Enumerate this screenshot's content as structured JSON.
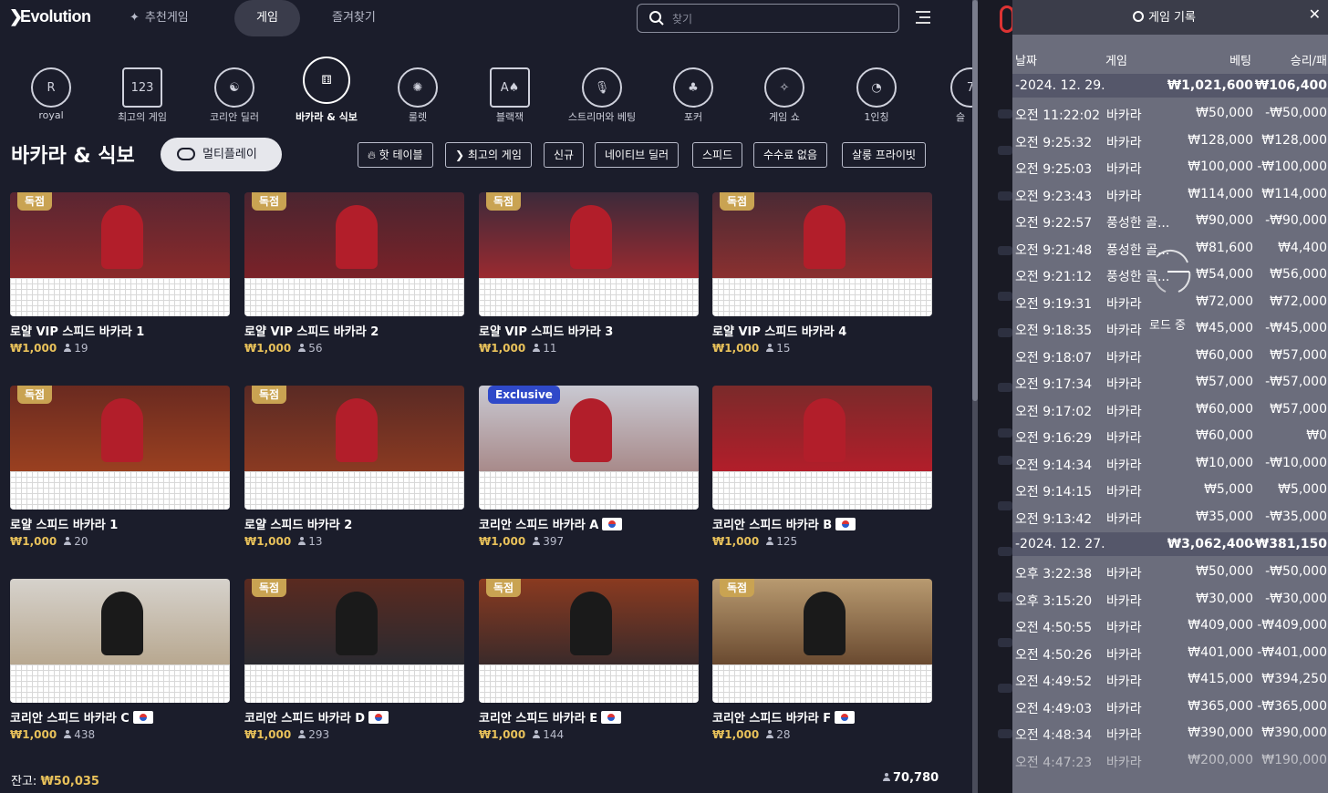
{
  "brand": {
    "name": "Evolution"
  },
  "nav": {
    "tabs": [
      {
        "label": "추천게임",
        "active": false
      },
      {
        "label": "게임",
        "active": true
      },
      {
        "label": "즐겨찾기",
        "active": false
      }
    ],
    "search_placeholder": "찾기"
  },
  "categories": [
    {
      "label": "royal",
      "icon": "royal-crest-icon"
    },
    {
      "label": "최고의 게임",
      "icon": "podium-icon"
    },
    {
      "label": "코리안 딜러",
      "icon": "korean-dealer-icon"
    },
    {
      "label": "바카라 & 식보",
      "icon": "baccarat-dice-icon",
      "active": true
    },
    {
      "label": "룰렛",
      "icon": "roulette-icon"
    },
    {
      "label": "블랙잭",
      "icon": "cards-icon"
    },
    {
      "label": "스트리머와 베팅",
      "icon": "microphone-icon"
    },
    {
      "label": "포커",
      "icon": "poker-icon"
    },
    {
      "label": "게임 쇼",
      "icon": "game-show-icon"
    },
    {
      "label": "1인칭",
      "icon": "first-person-icon"
    },
    {
      "label": "슬",
      "icon": "slot-icon"
    }
  ],
  "section": {
    "title": "바카라 & 식보",
    "multiplay_label": "멀티플레이",
    "filters": [
      "핫 테이블",
      "최고의 게임",
      "신규",
      "네이티브 딜러",
      "스피드",
      "수수료 없음",
      "살룽 프라이빗"
    ]
  },
  "tables": [
    {
      "name": "로얄 VIP 스피드 바카라 1",
      "price": "₩1,000",
      "players": "19",
      "badge": "독점",
      "flag": false
    },
    {
      "name": "로얄 VIP 스피드 바카라 2",
      "price": "₩1,000",
      "players": "56",
      "badge": "독점",
      "flag": false
    },
    {
      "name": "로얄 VIP 스피드 바카라 3",
      "price": "₩1,000",
      "players": "11",
      "badge": "독점",
      "flag": false
    },
    {
      "name": "로얄 VIP 스피드 바카라 4",
      "price": "₩1,000",
      "players": "15",
      "badge": "독점",
      "flag": false
    },
    {
      "name": "로얄 스피드 바카라 1",
      "price": "₩1,000",
      "players": "20",
      "badge": "독점",
      "flag": false
    },
    {
      "name": "로얄 스피드 바카라 2",
      "price": "₩1,000",
      "players": "13",
      "badge": "독점",
      "flag": false
    },
    {
      "name": "코리안 스피드 바카라 A",
      "price": "₩1,000",
      "players": "397",
      "badge": "Exclusive",
      "flag": true
    },
    {
      "name": "코리안 스피드 바카라 B",
      "price": "₩1,000",
      "players": "125",
      "badge": "",
      "flag": true
    },
    {
      "name": "코리안 스피드 바카라 C",
      "price": "₩1,000",
      "players": "438",
      "badge": "",
      "flag": true
    },
    {
      "name": "코리안 스피드 바카라 D",
      "price": "₩1,000",
      "players": "293",
      "badge": "독점",
      "flag": true
    },
    {
      "name": "코리안 스피드 바카라 E",
      "price": "₩1,000",
      "players": "144",
      "badge": "독점",
      "flag": true
    },
    {
      "name": "코리안 스피드 바카라 F",
      "price": "₩1,000",
      "players": "28",
      "badge": "독점",
      "flag": true
    }
  ],
  "footer": {
    "balance_label": "잔고:",
    "balance_value": "₩50,035",
    "online_count": "70,780"
  },
  "history": {
    "title": "게임 기록",
    "close": "✕",
    "columns": {
      "date": "날짜",
      "game": "게임",
      "bet": "베팅",
      "result": "승리/패"
    },
    "loading_text": "로드 중",
    "groups": [
      {
        "date": "-2024. 12. 29.",
        "bet_total": "₩1,021,600",
        "win_total": "₩106,400",
        "rows": [
          {
            "time": "오전 11:22:02",
            "game": "바카라",
            "bet": "₩50,000",
            "result": "-₩50,000"
          },
          {
            "time": "오전 9:25:32",
            "game": "바카라",
            "bet": "₩128,000",
            "result": "₩128,000"
          },
          {
            "time": "오전 9:25:03",
            "game": "바카라",
            "bet": "₩100,000",
            "result": "-₩100,000"
          },
          {
            "time": "오전 9:23:43",
            "game": "바카라",
            "bet": "₩114,000",
            "result": "₩114,000"
          },
          {
            "time": "오전 9:22:57",
            "game": "풍성한 골...",
            "bet": "₩90,000",
            "result": "-₩90,000"
          },
          {
            "time": "오전 9:21:48",
            "game": "풍성한 골...",
            "bet": "₩81,600",
            "result": "₩4,400"
          },
          {
            "time": "오전 9:21:12",
            "game": "풍성한 골...",
            "bet": "₩54,000",
            "result": "₩56,000"
          },
          {
            "time": "오전 9:19:31",
            "game": "바카라",
            "bet": "₩72,000",
            "result": "₩72,000"
          },
          {
            "time": "오전 9:18:35",
            "game": "바카라",
            "bet": "₩45,000",
            "result": "-₩45,000"
          },
          {
            "time": "오전 9:18:07",
            "game": "바카라",
            "bet": "₩60,000",
            "result": "₩57,000"
          },
          {
            "time": "오전 9:17:34",
            "game": "바카라",
            "bet": "₩57,000",
            "result": "-₩57,000"
          },
          {
            "time": "오전 9:17:02",
            "game": "바카라",
            "bet": "₩60,000",
            "result": "₩57,000"
          },
          {
            "time": "오전 9:16:29",
            "game": "바카라",
            "bet": "₩60,000",
            "result": "₩0"
          },
          {
            "time": "오전 9:14:34",
            "game": "바카라",
            "bet": "₩10,000",
            "result": "-₩10,000"
          },
          {
            "time": "오전 9:14:15",
            "game": "바카라",
            "bet": "₩5,000",
            "result": "₩5,000"
          },
          {
            "time": "오전 9:13:42",
            "game": "바카라",
            "bet": "₩35,000",
            "result": "-₩35,000"
          }
        ]
      },
      {
        "date": "-2024. 12. 27.",
        "bet_total": "₩3,062,400",
        "win_total": "-₩381,150",
        "rows": [
          {
            "time": "오후 3:22:38",
            "game": "바카라",
            "bet": "₩50,000",
            "result": "-₩50,000"
          },
          {
            "time": "오후 3:15:20",
            "game": "바카라",
            "bet": "₩30,000",
            "result": "-₩30,000"
          },
          {
            "time": "오전 4:50:55",
            "game": "바카라",
            "bet": "₩409,000",
            "result": "-₩409,000"
          },
          {
            "time": "오전 4:50:26",
            "game": "바카라",
            "bet": "₩401,000",
            "result": "-₩401,000"
          },
          {
            "time": "오전 4:49:52",
            "game": "바카라",
            "bet": "₩415,000",
            "result": "₩394,250"
          },
          {
            "time": "오전 4:49:03",
            "game": "바카라",
            "bet": "₩365,000",
            "result": "-₩365,000"
          },
          {
            "time": "오전 4:48:34",
            "game": "바카라",
            "bet": "₩390,000",
            "result": "₩390,000"
          },
          {
            "time": "오전 4:47:23",
            "game": "바카라",
            "bet": "₩200,000",
            "result": "₩190,000"
          }
        ]
      }
    ]
  },
  "colors": {
    "background": "#1b1d2b",
    "gold": "#e8c15a",
    "badge_gold": "#c9a352",
    "badge_exclusive": "#2f49c9",
    "history_panel": "#6b6d7c"
  }
}
